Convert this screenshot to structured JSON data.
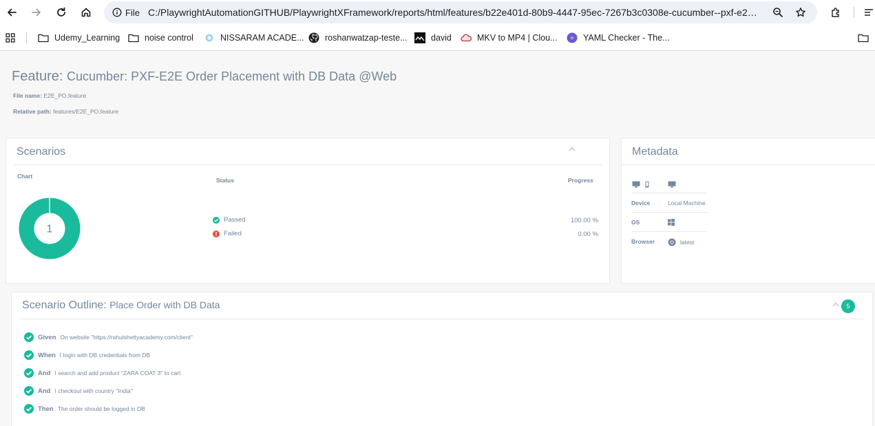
{
  "browser": {
    "site_info_label": "File",
    "url": "C:/PlaywrightAutomationGITHUB/PlaywrightXFramework/reports/html/features/b22e401d-80b9-4447-95ec-7267b3c0308e-cucumber--pxf-e2e...",
    "bookmarks": [
      {
        "label": "Udemy_Learning",
        "icon": "folder-icon"
      },
      {
        "label": "noise control",
        "icon": "folder-icon"
      },
      {
        "label": "NISSARAM ACADE...",
        "icon": "site-favicon"
      },
      {
        "label": "roshanwatzap-teste...",
        "icon": "github-icon"
      },
      {
        "label": "david",
        "icon": "site-favicon"
      },
      {
        "label": "MKV to MP4 | Clou...",
        "icon": "cloud-icon"
      },
      {
        "label": "YAML Checker - The...",
        "icon": "yaml-icon"
      }
    ]
  },
  "feature": {
    "keyword": "Feature:",
    "name": "Cucumber: PXF-E2E Order Placement with DB Data @Web",
    "file_name_label": "File name:",
    "file_name": "E2E_PO.feature",
    "relative_path_label": "Relative path:",
    "relative_path": "features/E2E_PO.feature"
  },
  "scenarios": {
    "title": "Scenarios",
    "chart_label": "Chart",
    "status_label": "Status",
    "progress_label": "Progress",
    "donut_center": "1",
    "rows": [
      {
        "status": "Passed",
        "progress": "100.00 %",
        "color": "#1abb9c"
      },
      {
        "status": "Failed",
        "progress": "0.00 %",
        "color": "#e74c3c"
      }
    ]
  },
  "metadata": {
    "title": "Metadata",
    "device_label": "Device",
    "device_value": "Local Machine",
    "os_label": "OS",
    "browser_label": "Browser",
    "browser_value": "latest"
  },
  "outline": {
    "keyword": "Scenario Outline:",
    "name": "Place Order with DB Data",
    "count": "5",
    "steps": [
      {
        "keyword": "Given",
        "text": "On website \"https://rahulshettyacademy.com/client\""
      },
      {
        "keyword": "When",
        "text": "I login with DB credentials from DB"
      },
      {
        "keyword": "And",
        "text": "I search and add product \"ZARA COAT 3\" to cart"
      },
      {
        "keyword": "And",
        "text": "I checkout with country \"India\""
      },
      {
        "keyword": "Then",
        "text": "The order should be logged in DB"
      }
    ]
  },
  "colors": {
    "accent": "#1abb9c",
    "failed": "#e74c3c",
    "text": "#73879c"
  }
}
